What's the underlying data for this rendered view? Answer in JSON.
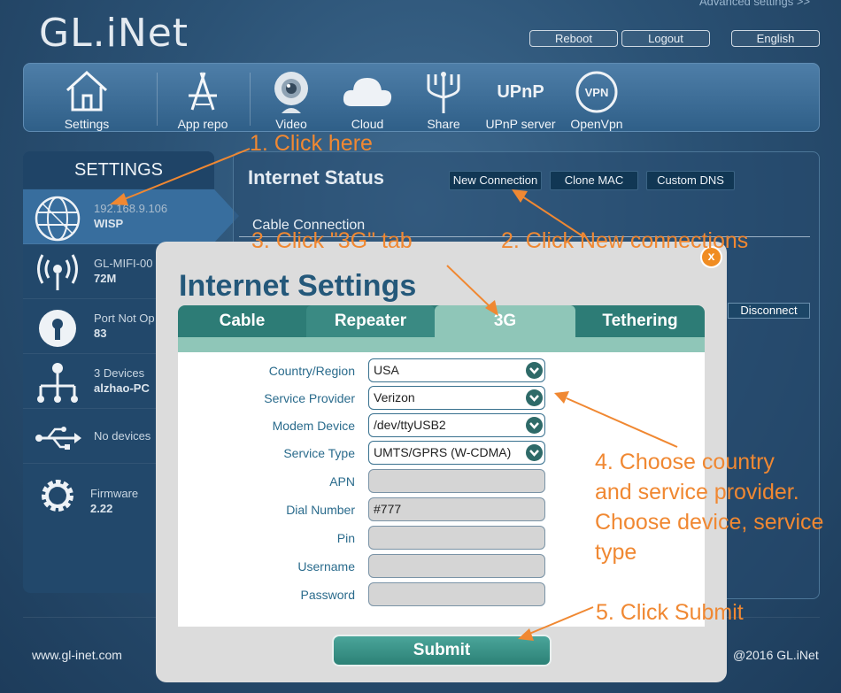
{
  "header": {
    "logo": "GL.iNet",
    "advanced_link": "Advanced settings >>",
    "reboot": "Reboot",
    "logout": "Logout",
    "language": "English"
  },
  "nav": [
    {
      "label": "Settings",
      "icon": "home-icon"
    },
    {
      "label": "App repo",
      "icon": "app-store-icon"
    },
    {
      "label": "Video",
      "icon": "webcam-icon"
    },
    {
      "label": "Cloud",
      "icon": "cloud-icon"
    },
    {
      "label": "Share",
      "icon": "usb-share-icon"
    },
    {
      "label": "UPnP server",
      "icon": "upnp-icon"
    },
    {
      "label": "OpenVpn",
      "icon": "vpn-icon"
    }
  ],
  "sidebar": {
    "title": "SETTINGS",
    "items": [
      {
        "line1": "192.168.9.106",
        "line2": "WISP",
        "icon": "globe-icon"
      },
      {
        "line1": "GL-MIFI-00",
        "line2": "72M",
        "icon": "wifi-antenna-icon"
      },
      {
        "line1": "Port Not Op",
        "line2": "83",
        "icon": "keyhole-icon"
      },
      {
        "line1": "3 Devices",
        "line2": "alzhao-PC",
        "icon": "network-tree-icon"
      },
      {
        "line1": "No devices",
        "line2": "",
        "icon": "usb-icon"
      },
      {
        "line1": "Firmware",
        "line2": "2.22",
        "icon": "gear-icon"
      }
    ]
  },
  "main": {
    "title": "Internet Status",
    "new_connection": "New Connection",
    "clone_mac": "Clone MAC",
    "custom_dns": "Custom DNS",
    "cable_connection": "Cable Connection",
    "disconnect": "Disconnect"
  },
  "modal": {
    "title": "Internet Settings",
    "close": "x",
    "tabs": [
      "Cable",
      "Repeater",
      "3G",
      "Tethering"
    ],
    "active_tab": "3G",
    "fields": [
      {
        "label": "Country/Region",
        "value": "USA",
        "type": "select"
      },
      {
        "label": "Service Provider",
        "value": "Verizon",
        "type": "select"
      },
      {
        "label": "Modem Device",
        "value": "/dev/ttyUSB2",
        "type": "select"
      },
      {
        "label": "Service Type",
        "value": "UMTS/GPRS (W-CDMA)",
        "type": "select"
      },
      {
        "label": "APN",
        "value": "",
        "type": "text"
      },
      {
        "label": "Dial Number",
        "value": "#777",
        "type": "text"
      },
      {
        "label": "Pin",
        "value": "",
        "type": "text"
      },
      {
        "label": "Username",
        "value": "",
        "type": "text"
      },
      {
        "label": "Password",
        "value": "",
        "type": "password"
      }
    ],
    "submit": "Submit"
  },
  "annotations": {
    "a1": "1. Click here",
    "a2": "2. Click New connections",
    "a3": "3. Click \"3G\" tab",
    "a4_l1": "4. Choose country",
    "a4_l2": "and service provider.",
    "a4_l3": "Choose device, service",
    "a4_l4": "type",
    "a5": "5. Click Submit"
  },
  "footer": {
    "left": "www.gl-inet.com",
    "right": "@2016 GL.iNet"
  },
  "colors": {
    "background": "#2b5275",
    "accent_teal": "#2d7c76",
    "annotation_orange": "#f08832",
    "modal_title": "#24587a"
  }
}
